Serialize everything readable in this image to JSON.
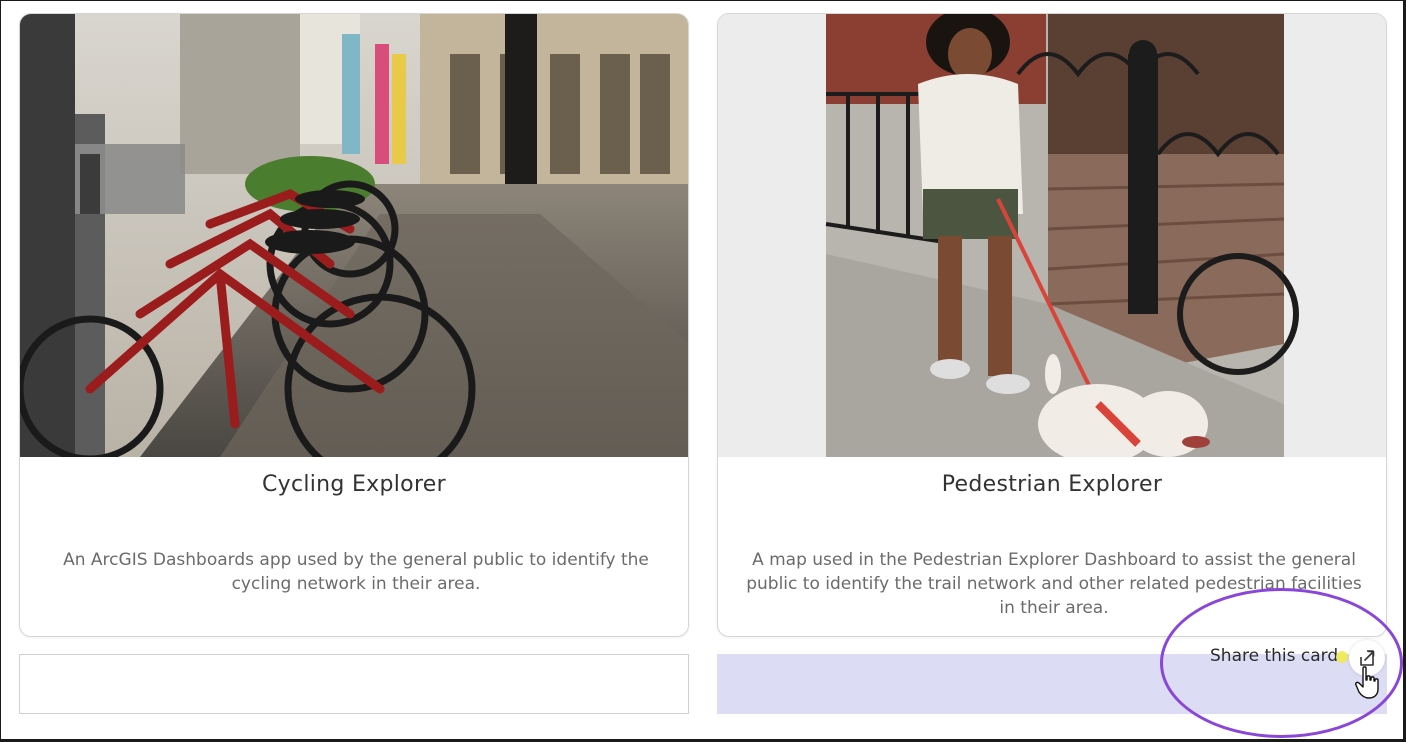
{
  "cards": [
    {
      "title": "Cycling Explorer",
      "description": "An ArcGIS Dashboards app used by the general public to identify the cycling network in their area.",
      "image_alt": "Red bike-share bicycles docked on a city sidewalk"
    },
    {
      "title": "Pedestrian Explorer",
      "description": "A map used in the Pedestrian Explorer Dashboard to assist the general public to identify the trail network and other related pedestrian facilities in their area.",
      "image_alt": "Woman walking a white dog on a red leash past brownstone steps"
    }
  ],
  "share": {
    "label": "Share this card"
  },
  "colors": {
    "highlight": "#8a46d9",
    "accent_card_bg": "#dcdcf5",
    "title_text": "#333333",
    "desc_text": "#6b6b6b"
  },
  "icons": [
    "share-icon",
    "hand-cursor-icon"
  ]
}
